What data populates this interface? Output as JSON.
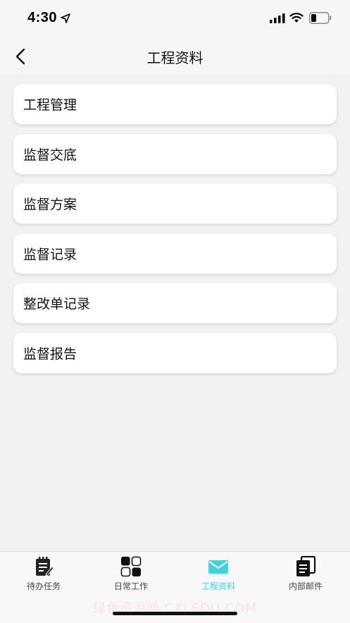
{
  "status_bar": {
    "time": "4:30"
  },
  "nav": {
    "title": "工程资料"
  },
  "menu_items": [
    {
      "label": "工程管理"
    },
    {
      "label": "监督交底"
    },
    {
      "label": "监督方案"
    },
    {
      "label": "监督记录"
    },
    {
      "label": "整改单记录"
    },
    {
      "label": "监督报告"
    }
  ],
  "tab_bar": {
    "tabs": [
      {
        "label": "待办任务",
        "icon": "todo-icon"
      },
      {
        "label": "日常工作",
        "icon": "grid-icon"
      },
      {
        "label": "工程资料",
        "icon": "mail-icon",
        "active": true
      },
      {
        "label": "内部邮件",
        "icon": "documents-icon"
      }
    ],
    "active_color": "#3fd3e0"
  },
  "watermark": "绿色资源网 CXLEDU.COM"
}
